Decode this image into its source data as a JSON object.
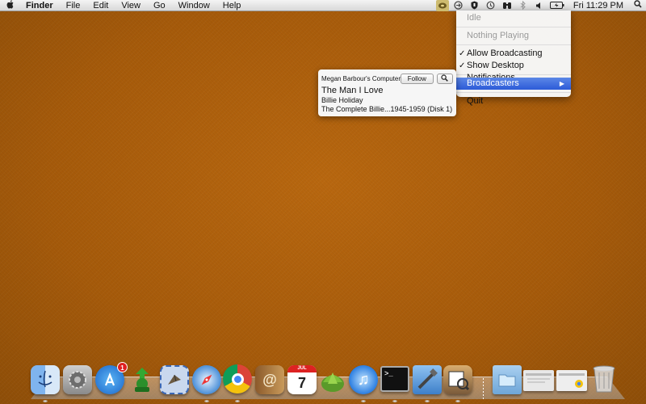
{
  "menubar": {
    "apple": "",
    "items": [
      "Finder",
      "File",
      "Edit",
      "View",
      "Go",
      "Window",
      "Help"
    ],
    "clock": "Fri 11:29 PM",
    "status_icons": [
      "broadcast-app-icon",
      "sync-icon",
      "shield-icon",
      "time-machine-icon",
      "binoculars-icon",
      "bluetooth-icon",
      "volume-icon",
      "battery-icon"
    ]
  },
  "dropdown": {
    "items": [
      {
        "label": "Idle",
        "disabled": true
      },
      {
        "label": "Nothing Playing",
        "disabled": true
      },
      {
        "label": "Allow Broadcasting",
        "checked": true
      },
      {
        "label": "Show Desktop Notifications",
        "checked": true
      },
      {
        "label": "Broadcasters",
        "submenu": true,
        "selected": true
      },
      {
        "label": "Quit"
      }
    ]
  },
  "card": {
    "computer": "Megan Barbour's Computer",
    "follow": "Follow",
    "song": "The Man I Love",
    "artist": "Billie Holiday",
    "album": "The Complete Billie...1945-1959 (Disk 1)"
  },
  "dock": {
    "apps": [
      {
        "name": "finder",
        "badge": ""
      },
      {
        "name": "system-preferences",
        "badge": ""
      },
      {
        "name": "app-store",
        "badge": "1"
      },
      {
        "name": "green-app",
        "badge": ""
      },
      {
        "name": "mail",
        "badge": ""
      },
      {
        "name": "safari",
        "badge": ""
      },
      {
        "name": "chrome",
        "badge": ""
      },
      {
        "name": "address-book",
        "badge": ""
      },
      {
        "name": "ical",
        "badge": "",
        "date_month": "JUL",
        "date_day": "7"
      },
      {
        "name": "growl",
        "badge": ""
      },
      {
        "name": "itunes",
        "badge": ""
      },
      {
        "name": "terminal",
        "badge": ""
      },
      {
        "name": "xcode",
        "badge": ""
      },
      {
        "name": "preview",
        "badge": ""
      },
      {
        "name": "applications-folder",
        "badge": ""
      },
      {
        "name": "window-1",
        "badge": ""
      },
      {
        "name": "window-2",
        "badge": ""
      },
      {
        "name": "trash",
        "badge": ""
      }
    ]
  }
}
